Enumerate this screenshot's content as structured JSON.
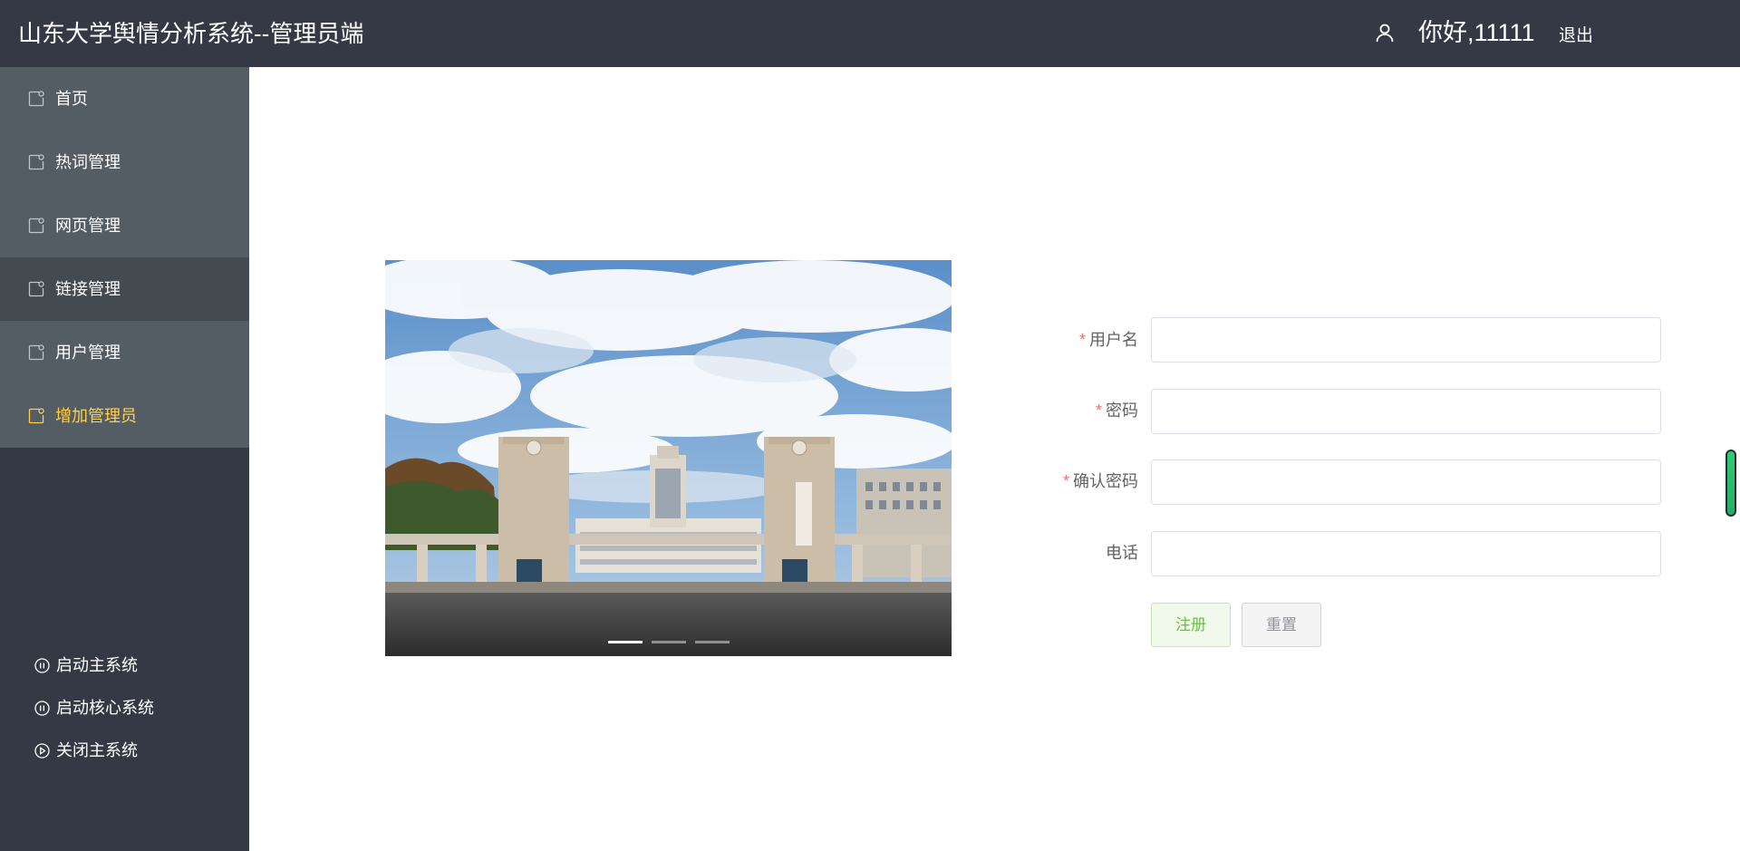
{
  "header": {
    "title": "山东大学舆情分析系统--管理员端",
    "greeting": "你好,11111",
    "logout_label": "退出"
  },
  "sidebar": {
    "menu": [
      {
        "label": "首页"
      },
      {
        "label": "热词管理"
      },
      {
        "label": "网页管理"
      },
      {
        "label": "链接管理"
      },
      {
        "label": "用户管理"
      },
      {
        "label": "增加管理员"
      }
    ],
    "active_item": "增加管理员",
    "actions": [
      {
        "label": "启动主系统",
        "icon": "pause-circle-icon"
      },
      {
        "label": "启动核心系统",
        "icon": "pause-circle-icon"
      },
      {
        "label": "关闭主系统",
        "icon": "play-circle-icon"
      }
    ]
  },
  "carousel": {
    "slide_count": 3,
    "active_index": 0
  },
  "form": {
    "username": {
      "label": "用户名",
      "required": true,
      "value": ""
    },
    "password": {
      "label": "密码",
      "required": true,
      "value": ""
    },
    "confirm_password": {
      "label": "确认密码",
      "required": true,
      "value": ""
    },
    "phone": {
      "label": "电话",
      "required": false,
      "value": ""
    },
    "register_label": "注册",
    "reset_label": "重置"
  },
  "colors": {
    "header_bg": "#343945",
    "menu_bg": "#545c64",
    "menu_active_text": "#ffd04b",
    "required_mark": "#f56c6c",
    "success": "#67c23a"
  }
}
